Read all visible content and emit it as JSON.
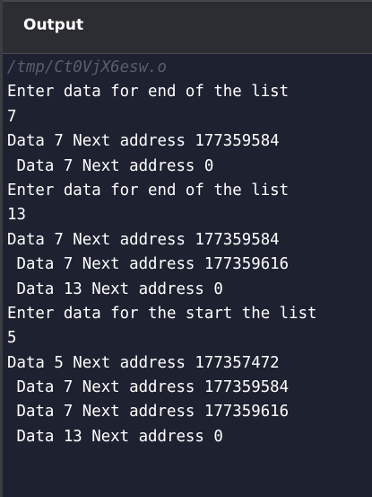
{
  "header": {
    "title": "Output"
  },
  "console": {
    "path": "/tmp/Ct0VjX6esw.o",
    "lines": [
      "Enter data for end of the list",
      "7",
      "Data 7 Next address 177359584",
      " Data 7 Next address 0",
      "Enter data for end of the list",
      "13",
      "Data 7 Next address 177359584",
      " Data 7 Next address 177359616",
      " Data 13 Next address 0",
      "Enter data for the start the list",
      "5",
      "Data 5 Next address 177357472",
      " Data 7 Next address 177359584",
      " Data 7 Next address 177359616",
      " Data 13 Next address 0"
    ]
  }
}
